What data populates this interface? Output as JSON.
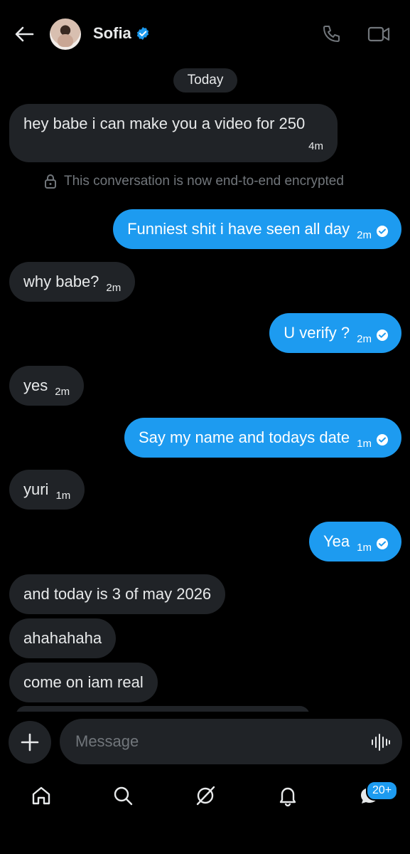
{
  "header": {
    "contact_name": "Sofia",
    "icons": [
      "back-arrow-icon",
      "verified-badge-icon",
      "phone-icon",
      "video-call-icon"
    ]
  },
  "date_label": "Today",
  "encryption_notice": "This conversation is now end-to-end encrypted",
  "messages": [
    {
      "from": "them",
      "text": "hey babe i can make you a video for 250",
      "time": "4m"
    },
    {
      "from": "me",
      "text": "Funniest shit i have seen all day",
      "time": "2m"
    },
    {
      "from": "them",
      "text": "why babe?",
      "time": "2m"
    },
    {
      "from": "me",
      "text": "U verify ?",
      "time": "2m"
    },
    {
      "from": "them",
      "text": "yes",
      "time": "2m"
    },
    {
      "from": "me",
      "text": "Say my name and todays date",
      "time": "1m"
    },
    {
      "from": "them",
      "text": "yuri",
      "time": "1m"
    },
    {
      "from": "me",
      "text": "Yea",
      "time": "1m"
    },
    {
      "from": "them",
      "text": "and today is 3 of may 2026",
      "time": ""
    },
    {
      "from": "them",
      "text": "ahahahaha",
      "time": ""
    },
    {
      "from": "them",
      "text": "come on iam real",
      "time": ""
    }
  ],
  "composer": {
    "placeholder": "Message"
  },
  "navbar": {
    "items": [
      "home-icon",
      "search-icon",
      "grok-icon",
      "notifications-icon",
      "messages-icon"
    ],
    "messages_badge": "20+"
  },
  "colors": {
    "accent": "#1d9bf0",
    "received_bubble": "#202327",
    "muted_text": "#71767b",
    "background": "#000000"
  }
}
